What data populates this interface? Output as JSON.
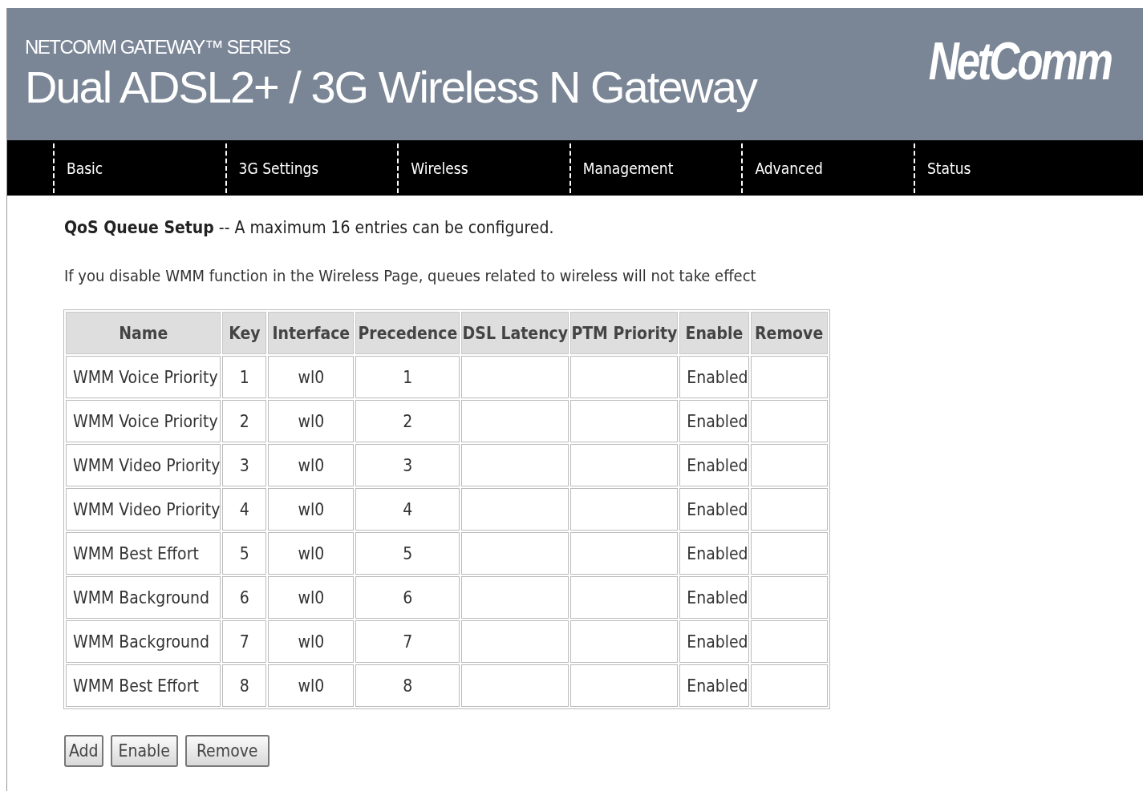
{
  "header": {
    "series": "NETCOMM GATEWAY™ SERIES",
    "title": "Dual ADSL2+ / 3G Wireless N Gateway",
    "logo": "NetComm"
  },
  "nav": [
    "Basic",
    "3G Settings",
    "Wireless",
    "Management",
    "Advanced",
    "Status"
  ],
  "heading": {
    "title": "QoS Queue Setup",
    "note": "-- A maximum 16 entries can be configured."
  },
  "info": "If you disable WMM function in the Wireless Page, queues related to wireless will not take effect",
  "table": {
    "columns": [
      "Name",
      "Key",
      "Interface",
      "Precedence",
      "DSL Latency",
      "PTM Priority",
      "Enable",
      "Remove"
    ],
    "rows": [
      [
        "WMM Voice Priority",
        "1",
        "wl0",
        "1",
        "",
        "",
        "Enabled",
        ""
      ],
      [
        "WMM Voice Priority",
        "2",
        "wl0",
        "2",
        "",
        "",
        "Enabled",
        ""
      ],
      [
        "WMM Video Priority",
        "3",
        "wl0",
        "3",
        "",
        "",
        "Enabled",
        ""
      ],
      [
        "WMM Video Priority",
        "4",
        "wl0",
        "4",
        "",
        "",
        "Enabled",
        ""
      ],
      [
        "WMM Best Effort",
        "5",
        "wl0",
        "5",
        "",
        "",
        "Enabled",
        ""
      ],
      [
        "WMM Background",
        "6",
        "wl0",
        "6",
        "",
        "",
        "Enabled",
        ""
      ],
      [
        "WMM Background",
        "7",
        "wl0",
        "7",
        "",
        "",
        "Enabled",
        ""
      ],
      [
        "WMM Best Effort",
        "8",
        "wl0",
        "8",
        "",
        "",
        "Enabled",
        ""
      ]
    ]
  },
  "buttons": [
    "Add",
    "Enable",
    "Remove"
  ]
}
